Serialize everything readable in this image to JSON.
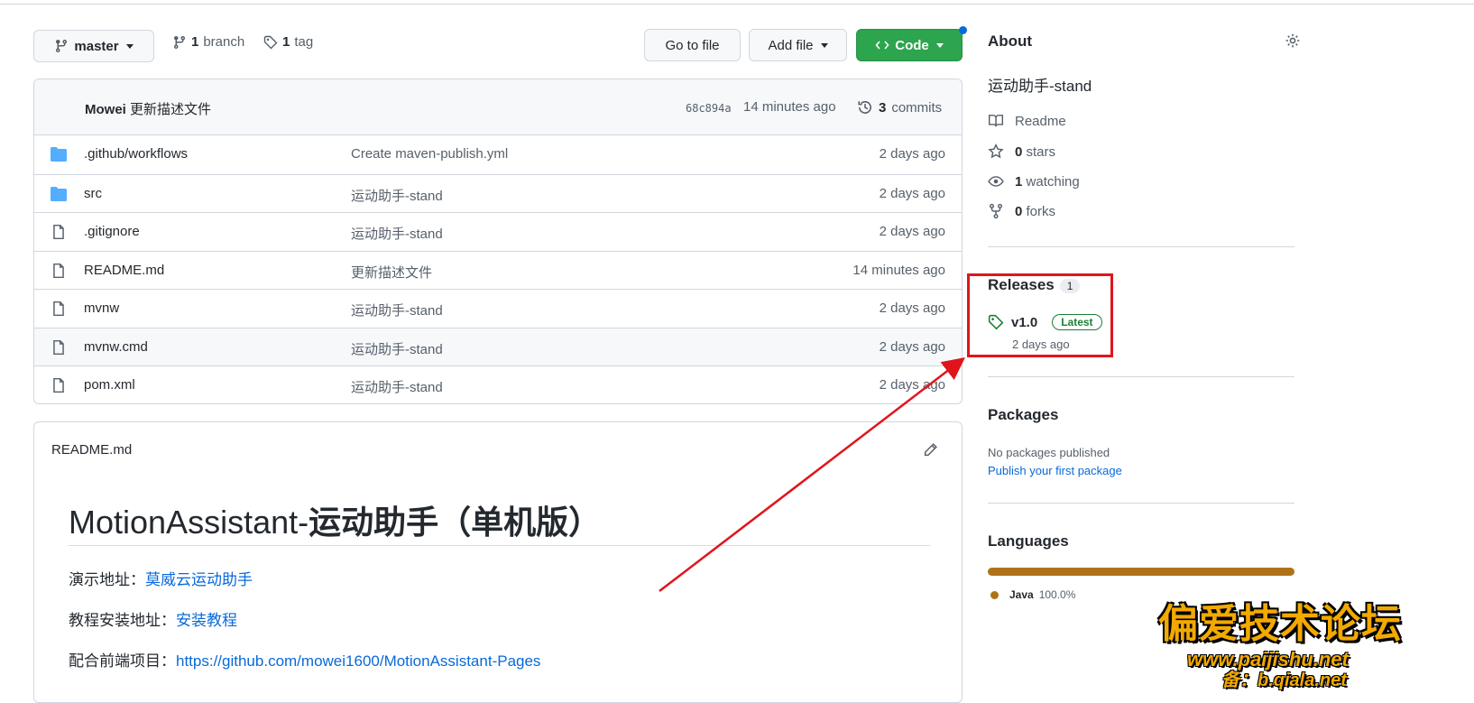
{
  "toolbar": {
    "branch_name": "master",
    "branches_count": "1",
    "branches_label": "branch",
    "tags_count": "1",
    "tags_label": "tag",
    "go_to_file": "Go to file",
    "add_file": "Add file",
    "code": "Code"
  },
  "commit": {
    "author": "Mowei",
    "message": "更新描述文件",
    "sha": "68c894a",
    "time": "14 minutes ago",
    "commits_count": "3",
    "commits_label": "commits"
  },
  "files": [
    {
      "name": ".github/workflows",
      "message": "Create maven-publish.yml",
      "date": "2 days ago",
      "type": "folder"
    },
    {
      "name": "src",
      "message": "运动助手-stand",
      "date": "2 days ago",
      "type": "folder"
    },
    {
      "name": ".gitignore",
      "message": "运动助手-stand",
      "date": "2 days ago",
      "type": "file"
    },
    {
      "name": "README.md",
      "message": "更新描述文件",
      "date": "14 minutes ago",
      "type": "file"
    },
    {
      "name": "mvnw",
      "message": "运动助手-stand",
      "date": "2 days ago",
      "type": "file"
    },
    {
      "name": "mvnw.cmd",
      "message": "运动助手-stand",
      "date": "2 days ago",
      "type": "file"
    },
    {
      "name": "pom.xml",
      "message": "运动助手-stand",
      "date": "2 days ago",
      "type": "file"
    }
  ],
  "readme": {
    "header": "README.md",
    "title_prefix": "MotionAssistant-",
    "title_bold": "运动助手（单机版）",
    "demo_label": "演示地址：",
    "demo_link": "莫威云运动助手",
    "tutorial_label": "教程安装地址：",
    "tutorial_link": "安装教程",
    "frontend_label": "配合前端项目：",
    "frontend_link": "https://github.com/mowei1600/MotionAssistant-Pages"
  },
  "about": {
    "title": "About",
    "description": "运动助手-stand",
    "readme": "Readme",
    "stars_count": "0",
    "stars_label": "stars",
    "watching_count": "1",
    "watching_label": "watching",
    "forks_count": "0",
    "forks_label": "forks"
  },
  "releases": {
    "title": "Releases",
    "count": "1",
    "version": "v1.0",
    "badge": "Latest",
    "date": "2 days ago"
  },
  "packages": {
    "title": "Packages",
    "empty": "No packages published",
    "publish_link": "Publish your first package"
  },
  "languages": {
    "title": "Languages",
    "items": [
      {
        "name": "Java",
        "percent": "100.0%",
        "color": "#b07219"
      }
    ]
  },
  "watermark": {
    "title": "偏爱技术论坛",
    "url": "www.paijishu.net",
    "beian": "备：b.qiala.net"
  },
  "colors": {
    "accent_green": "#2da44e",
    "link_blue": "#0969da",
    "annotation_red": "#e0151c"
  }
}
